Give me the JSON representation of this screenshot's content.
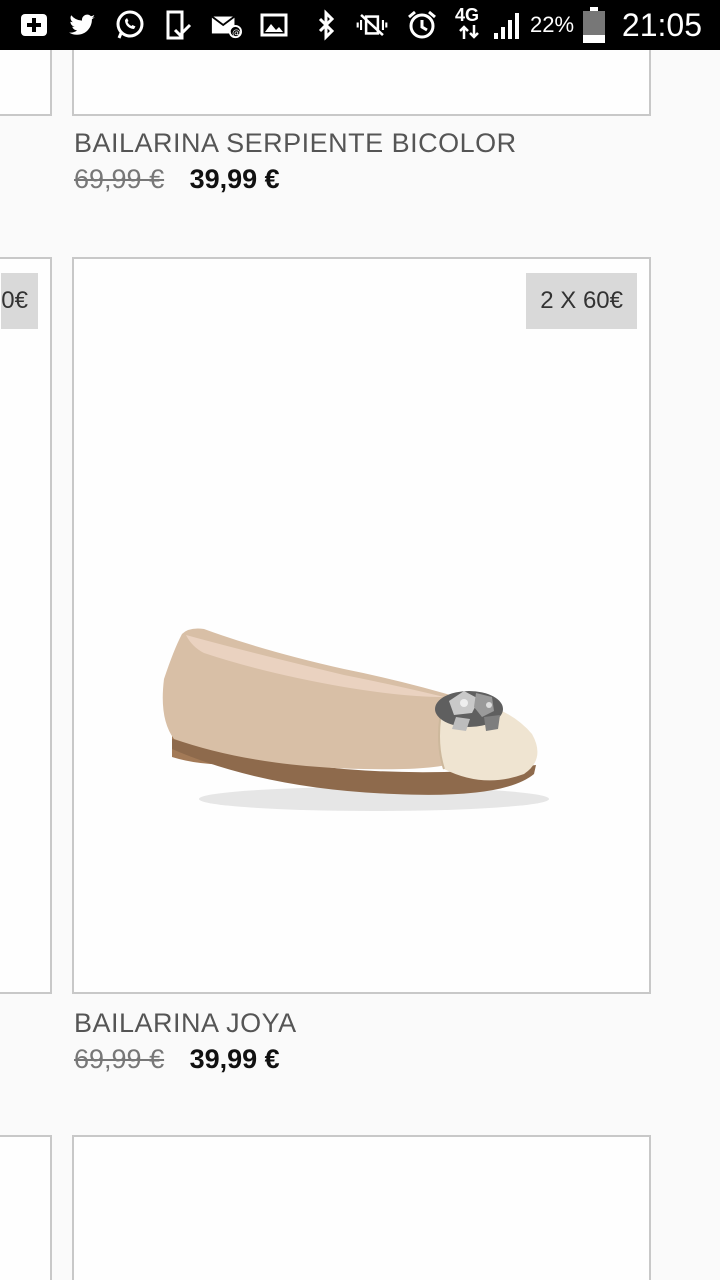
{
  "status_bar": {
    "battery": "22%",
    "network": "4G",
    "time": "21:05"
  },
  "products": [
    {
      "name": "BAILARINA SERPIENTE BICOLOR",
      "old_price": "69,99 €",
      "new_price": "39,99 €"
    },
    {
      "name": "BAILARINA JOYA",
      "old_price": "69,99 €",
      "new_price": "39,99 €",
      "badge": "2 X 60€",
      "image_alt": "beige suede ballet flat with jeweled toe cap"
    }
  ],
  "left_badge_partial": "0€",
  "colors": {
    "border": "#c8c8c8",
    "badge_bg": "#d9d9d9",
    "shoe_suede": "#d8bfa6",
    "shoe_cap": "#efe4d1"
  }
}
